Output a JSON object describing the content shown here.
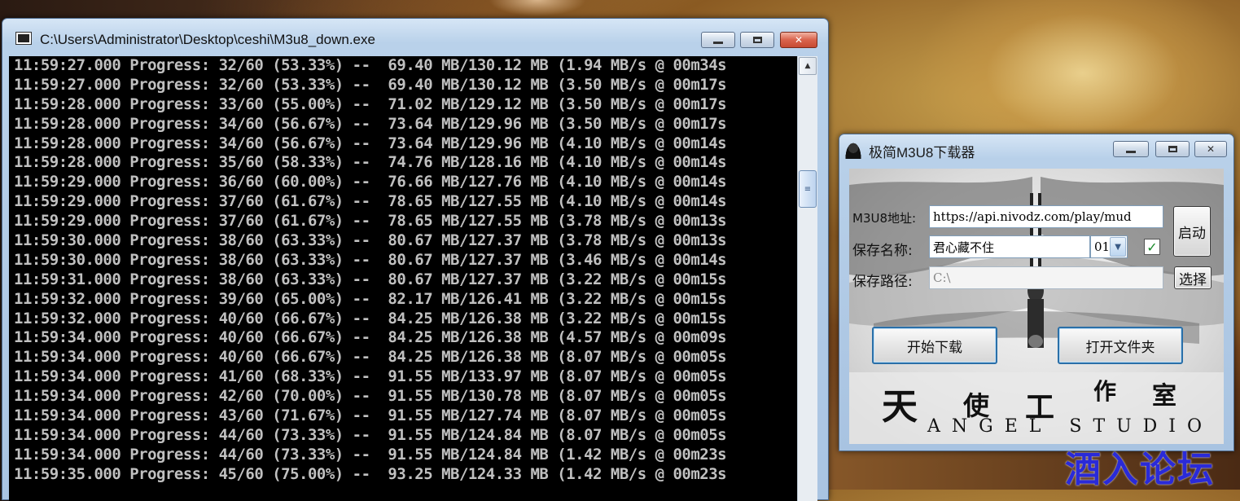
{
  "console": {
    "title": "C:\\Users\\Administrator\\Desktop\\ceshi\\M3u8_down.exe",
    "lines": [
      "11:59:27.000 Progress: 32/60 (53.33%) --  69.40 MB/130.12 MB (1.94 MB/s @ 00m34s",
      "11:59:27.000 Progress: 32/60 (53.33%) --  69.40 MB/130.12 MB (3.50 MB/s @ 00m17s",
      "11:59:28.000 Progress: 33/60 (55.00%) --  71.02 MB/129.12 MB (3.50 MB/s @ 00m17s",
      "11:59:28.000 Progress: 34/60 (56.67%) --  73.64 MB/129.96 MB (3.50 MB/s @ 00m17s",
      "11:59:28.000 Progress: 34/60 (56.67%) --  73.64 MB/129.96 MB (4.10 MB/s @ 00m14s",
      "11:59:28.000 Progress: 35/60 (58.33%) --  74.76 MB/128.16 MB (4.10 MB/s @ 00m14s",
      "11:59:29.000 Progress: 36/60 (60.00%) --  76.66 MB/127.76 MB (4.10 MB/s @ 00m14s",
      "11:59:29.000 Progress: 37/60 (61.67%) --  78.65 MB/127.55 MB (4.10 MB/s @ 00m14s",
      "11:59:29.000 Progress: 37/60 (61.67%) --  78.65 MB/127.55 MB (3.78 MB/s @ 00m13s",
      "11:59:30.000 Progress: 38/60 (63.33%) --  80.67 MB/127.37 MB (3.78 MB/s @ 00m13s",
      "11:59:30.000 Progress: 38/60 (63.33%) --  80.67 MB/127.37 MB (3.46 MB/s @ 00m14s",
      "11:59:31.000 Progress: 38/60 (63.33%) --  80.67 MB/127.37 MB (3.22 MB/s @ 00m15s",
      "11:59:32.000 Progress: 39/60 (65.00%) --  82.17 MB/126.41 MB (3.22 MB/s @ 00m15s",
      "11:59:32.000 Progress: 40/60 (66.67%) --  84.25 MB/126.38 MB (3.22 MB/s @ 00m15s",
      "11:59:34.000 Progress: 40/60 (66.67%) --  84.25 MB/126.38 MB (4.57 MB/s @ 00m09s",
      "11:59:34.000 Progress: 40/60 (66.67%) --  84.25 MB/126.38 MB (8.07 MB/s @ 00m05s",
      "11:59:34.000 Progress: 41/60 (68.33%) --  91.55 MB/133.97 MB (8.07 MB/s @ 00m05s",
      "11:59:34.000 Progress: 42/60 (70.00%) --  91.55 MB/130.78 MB (8.07 MB/s @ 00m05s",
      "11:59:34.000 Progress: 43/60 (71.67%) --  91.55 MB/127.74 MB (8.07 MB/s @ 00m05s",
      "11:59:34.000 Progress: 44/60 (73.33%) --  91.55 MB/124.84 MB (8.07 MB/s @ 00m05s",
      "11:59:34.000 Progress: 44/60 (73.33%) --  91.55 MB/124.84 MB (1.42 MB/s @ 00m23s",
      "11:59:35.000 Progress: 45/60 (75.00%) --  93.25 MB/124.33 MB (1.42 MB/s @ 00m23s"
    ],
    "text_color": "#c0c0c0",
    "background": "#000000"
  },
  "downloader": {
    "title": "极简M3U8下载器",
    "m3u8_label": "M3U8地址:",
    "m3u8_value": "https://api.nivodz.com/play/mud",
    "name_label": "保存名称:",
    "name_value": "君心藏不住",
    "episode_value": "01",
    "episode_checked": true,
    "path_label": "保存路径:",
    "path_value": "C:\\",
    "start_button": "启动",
    "choose_button": "选择",
    "download_button": "开始下载",
    "open_folder_button": "打开文件夹",
    "studio_cn": [
      "天",
      "使",
      "工",
      "作",
      "室"
    ],
    "studio_en": "ANGEL STUDIO"
  },
  "watermark": "酒入论坛",
  "icons": {
    "console_app": "console-window-icon",
    "downloader_app": "angel-silhouette-icon",
    "minimize": "minimize-icon",
    "maximize": "maximize-icon",
    "close": "close-icon",
    "combo_arrow": "chevron-down-icon",
    "check": "checkmark-icon"
  },
  "colors": {
    "accent_button_border": "#2a6fa8",
    "watermark": "#2a2ad8",
    "check": "#1a8a2a"
  }
}
